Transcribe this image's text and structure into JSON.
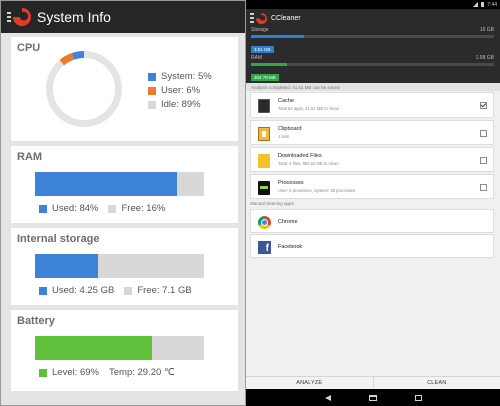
{
  "left": {
    "title": "System Info",
    "cpu": {
      "title": "CPU",
      "system_label": "System: 5%",
      "user_label": "User: 6%",
      "idle_label": "Idle: 89%",
      "system_pct": 5,
      "user_pct": 6,
      "idle_pct": 89
    },
    "ram": {
      "title": "RAM",
      "used_label": "Used: 84%",
      "free_label": "Free: 16%",
      "used_fraction": 0.84
    },
    "storage": {
      "title": "Internal storage",
      "used_label": "Used: 4.25 GB",
      "free_label": "Free: 7.1 GB",
      "used_fraction": 0.37
    },
    "battery": {
      "title": "Battery",
      "level_label": "Level: 69%",
      "temp_label": "Temp: 29.20 ℃",
      "level_fraction": 0.69
    }
  },
  "right": {
    "app_title": "CCleaner",
    "status_time": "7:44",
    "storage": {
      "label": "Storage",
      "total": "16 GB",
      "used": "3.51 GB",
      "used_fraction": 0.22
    },
    "ram": {
      "label": "RAM",
      "total": "1.98 GB",
      "used": "304.78 MB",
      "used_fraction": 0.15
    },
    "analysis_text": "Analysis completed: 41.51 MB can be saved",
    "items": [
      {
        "name": "Cache",
        "sub": "Total 52 apps, 41.51 MB to clean",
        "icon": "phone-icon",
        "checked": true
      },
      {
        "name": "Clipboard",
        "sub": "1 item",
        "icon": "clipboard-icon",
        "checked": false
      },
      {
        "name": "Downloaded Files",
        "sub": "Total: 4 files, 960.62 MB to clean",
        "icon": "folder-icon",
        "checked": false
      },
      {
        "name": "Processes",
        "sub": "User: 6 processes, System: 35 processes",
        "icon": "process-icon",
        "checked": false
      }
    ],
    "manual_label": "Manual cleaning apps",
    "manual_items": [
      {
        "name": "Chrome",
        "icon": "chrome-icon"
      },
      {
        "name": "Facebook",
        "icon": "facebook-icon"
      }
    ],
    "analyze_label": "ANALYZE",
    "clean_label": "CLEAN"
  },
  "colors": {
    "blue": "#3c83d9",
    "orange": "#ef7a2c",
    "green": "#5fc23a",
    "track_gray": "#d8d8d8",
    "dark_bar": "#262626"
  }
}
